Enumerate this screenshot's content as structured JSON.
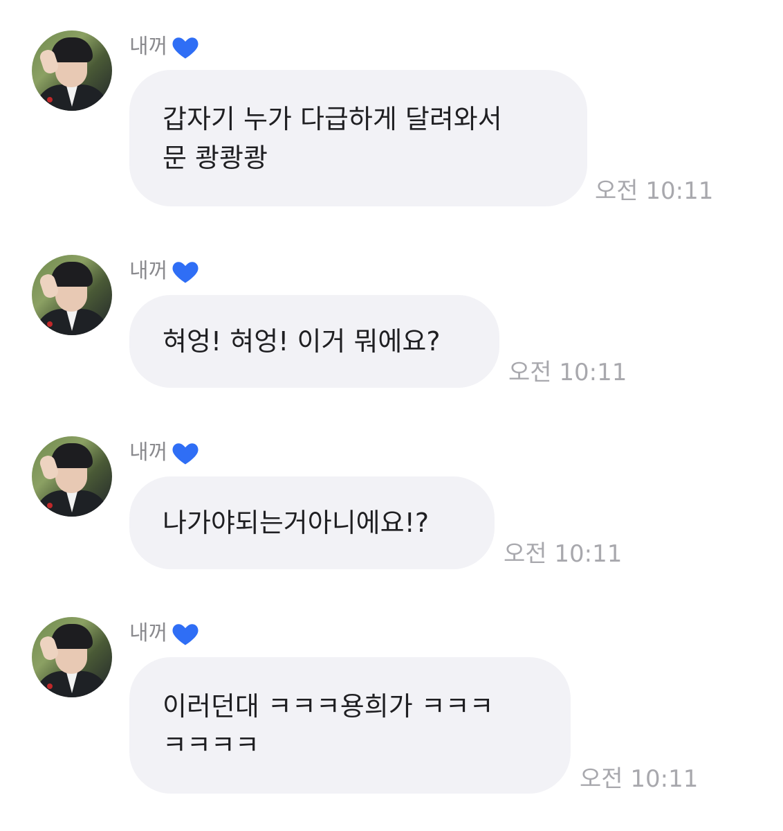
{
  "messages": [
    {
      "sender": "내꺼",
      "lines": [
        "갑자기 누가 다급하게 달려와서",
        "문 쾅쾅쾅"
      ],
      "time": "오전 10:11"
    },
    {
      "sender": "내꺼",
      "lines": [
        "혀엉! 혀엉! 이거 뭐에요?"
      ],
      "time": "오전 10:11"
    },
    {
      "sender": "내꺼",
      "lines": [
        "나가야되는거아니에요!?"
      ],
      "time": "오전 10:11"
    },
    {
      "sender": "내꺼",
      "lines": [
        "이러던대 ㅋㅋㅋ용희가 ㅋㅋㅋ",
        "ㅋㅋㅋㅋ"
      ],
      "time": "오전 10:11"
    }
  ],
  "icons": {
    "heart": "blue-heart-icon",
    "heart_color": "#2f6ef5"
  },
  "colors": {
    "bubble": "#f2f2f6",
    "time": "#a8a8ad",
    "name": "#8a8a8e"
  }
}
